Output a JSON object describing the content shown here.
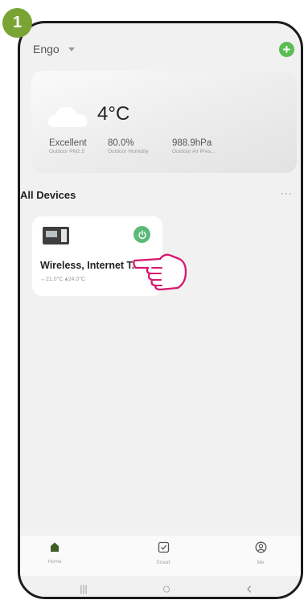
{
  "step_number": "1",
  "header": {
    "home_name": "Engo",
    "add_icon": "plus-icon"
  },
  "weather": {
    "icon": "cloud-icon",
    "temperature": "4°C",
    "metrics": [
      {
        "value": "Excellent",
        "label": "Outdoor PM2.5"
      },
      {
        "value": "80.0%",
        "label": "Outdoor Humidity"
      },
      {
        "value": "988.9hPa",
        "label": "Outdoor Air Pres..."
      }
    ]
  },
  "devices_section": {
    "title": "All Devices",
    "more": "···"
  },
  "device": {
    "name": "Wireless, Internet T...",
    "temps": "↔21.0°C  🌢24.0°C",
    "power_icon": "power-icon",
    "power_color": "#5cba78"
  },
  "tabs": [
    {
      "label": "Home",
      "icon": "home-icon"
    },
    {
      "label": "Smart",
      "icon": "checkbox-icon"
    },
    {
      "label": "Me",
      "icon": "profile-icon"
    }
  ],
  "system_nav": {
    "recents": "|||",
    "home": "○",
    "back": "‹"
  },
  "colors": {
    "accent_green": "#5bbd54",
    "badge_green": "#79a434",
    "hand_pink": "#d6186e"
  }
}
